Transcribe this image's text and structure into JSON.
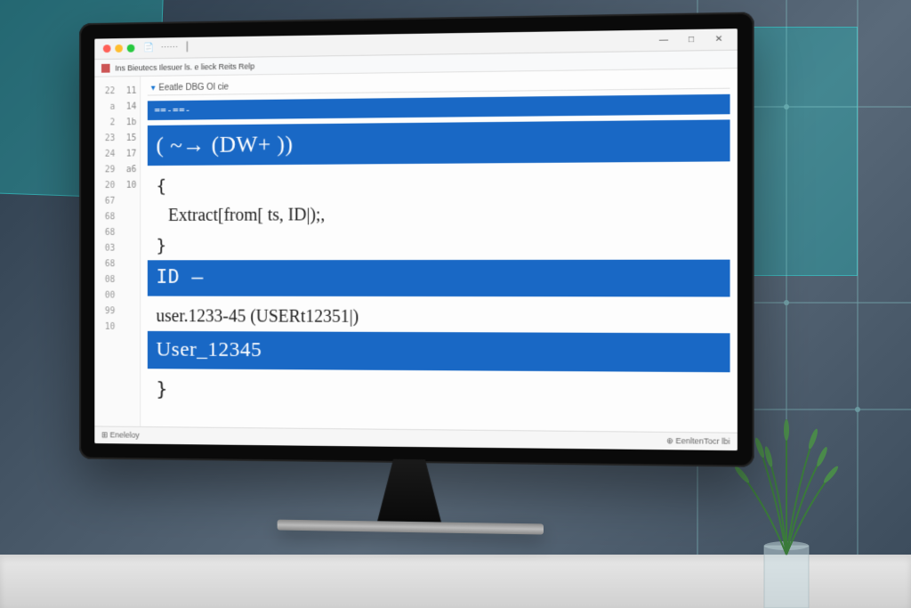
{
  "window": {
    "minimize_glyph": "—",
    "maximize_glyph": "□",
    "close_glyph": "✕"
  },
  "menubar": {
    "text": "Ins Bieutecs  Ilesuer ls. e lieck  Reits  Relp"
  },
  "tab": {
    "label": "Eeatle  DBG Ol cie"
  },
  "gutter1": [
    "22",
    "a",
    "2",
    "23",
    "24",
    "29",
    "20",
    "67",
    "68",
    "68",
    "03",
    "68",
    "08",
    "00",
    "99",
    "10"
  ],
  "gutter2": [
    "11",
    "14",
    "1b",
    "15",
    "17",
    "a6",
    "",
    "",
    "",
    "",
    "",
    "",
    "",
    "",
    "",
    "10"
  ],
  "code": {
    "line_separator": "==-==-",
    "regex": "( ~→ (DW+ ))",
    "brace_open": "{",
    "extract_call": "Extract[from[ ts,   ID|);,",
    "brace_close": "}",
    "id_label": "ID –",
    "user_sample": "user.1233-45 (USERt12351|)",
    "user_result": "User_12345",
    "final_brace": "}"
  },
  "statusbar": {
    "left": "⊞ Eneleloy",
    "right": "⊕ EenltenTocr lbi"
  }
}
